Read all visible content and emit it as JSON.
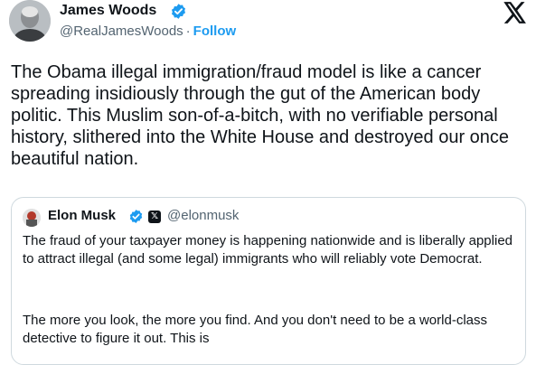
{
  "author": {
    "name": "James Woods",
    "handle": "@RealJamesWoods",
    "separator": "·",
    "follow_label": "Follow"
  },
  "icons": {
    "verified": "verified-badge-icon",
    "x_logo": "x-logo-icon",
    "affiliate": "x-affiliate-badge-icon"
  },
  "colors": {
    "verified": "#1d9bf0",
    "follow": "#1d9bf0",
    "secondary_text": "#536471",
    "border": "#cfd9de"
  },
  "tweet": {
    "text": "The Obama illegal immigration/fraud model is like a cancer spreading insidiously through the gut of the American body politic. This Muslim son-of-a-bitch, with no verifiable personal history, slithered into the White House and destroyed our once beautiful nation."
  },
  "quote": {
    "name": "Elon Musk",
    "handle": "@elonmusk",
    "text_1": "The fraud of your taxpayer money is happening nationwide and is liberally applied to attract illegal (and some legal) immigrants who will reliably vote Democrat.",
    "text_2": "The more you look, the more you find. And you don't need to be a world-class detective to figure it out. This is"
  }
}
